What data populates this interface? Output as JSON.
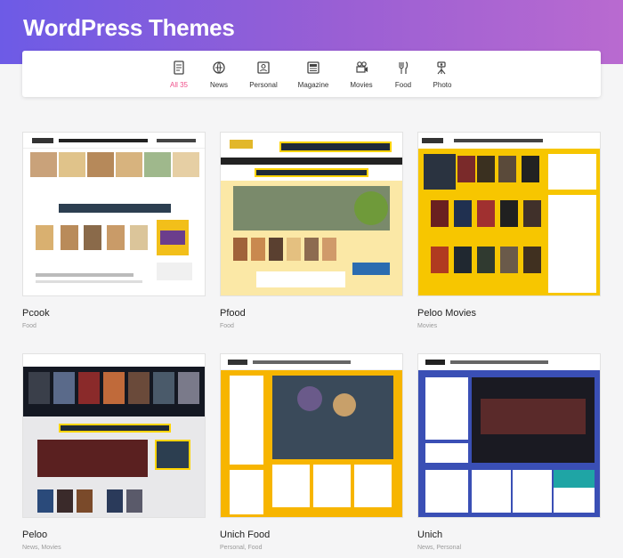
{
  "header": {
    "title": "WordPress Themes"
  },
  "filters": [
    {
      "label": "All 35",
      "icon": "all-icon",
      "active": true
    },
    {
      "label": "News",
      "icon": "news-icon"
    },
    {
      "label": "Personal",
      "icon": "personal-icon"
    },
    {
      "label": "Magazine",
      "icon": "magazine-icon"
    },
    {
      "label": "Movies",
      "icon": "movies-icon"
    },
    {
      "label": "Food",
      "icon": "food-icon"
    },
    {
      "label": "Photo",
      "icon": "photo-icon"
    }
  ],
  "themes": [
    {
      "name": "Pcook",
      "categories": "Food"
    },
    {
      "name": "Pfood",
      "categories": "Food"
    },
    {
      "name": "Peloo Movies",
      "categories": "Movies"
    },
    {
      "name": "Peloo",
      "categories": "News, Movies"
    },
    {
      "name": "Unich Food",
      "categories": "Personal, Food"
    },
    {
      "name": "Unich",
      "categories": "News, Personal"
    }
  ],
  "colors": {
    "active_tab": "#ef4f8a",
    "header_start": "#6d5be6",
    "header_end": "#b96ad0"
  }
}
